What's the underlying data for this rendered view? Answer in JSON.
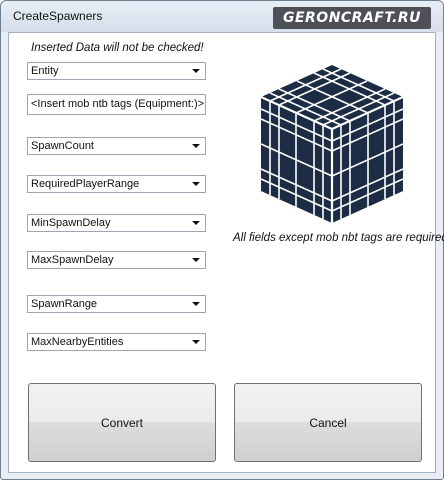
{
  "window": {
    "title": "CreateSpawners",
    "watermark": "GERONCRAFT.RU"
  },
  "notice": "Inserted Data will not be checked!",
  "required_note": "All fields except mob nbt tags are required!",
  "fields": {
    "entity": {
      "value": "Entity",
      "type": "dropdown"
    },
    "nbt_tags": {
      "value": "<Insert mob ntb tags  (Equipment:)>",
      "type": "text"
    },
    "spawn_count": {
      "value": "SpawnCount",
      "type": "dropdown"
    },
    "required_player_range": {
      "value": "RequiredPlayerRange",
      "type": "dropdown"
    },
    "min_spawn_delay": {
      "value": "MinSpawnDelay",
      "type": "dropdown"
    },
    "max_spawn_delay": {
      "value": "MaxSpawnDelay",
      "type": "dropdown"
    },
    "spawn_range": {
      "value": "SpawnRange",
      "type": "dropdown"
    },
    "max_nearby_entities": {
      "value": "MaxNearbyEntities",
      "type": "dropdown"
    }
  },
  "buttons": {
    "convert": "Convert",
    "cancel": "Cancel"
  },
  "image": {
    "icon": "spawner-cage-icon",
    "color": "#1c2c44"
  }
}
